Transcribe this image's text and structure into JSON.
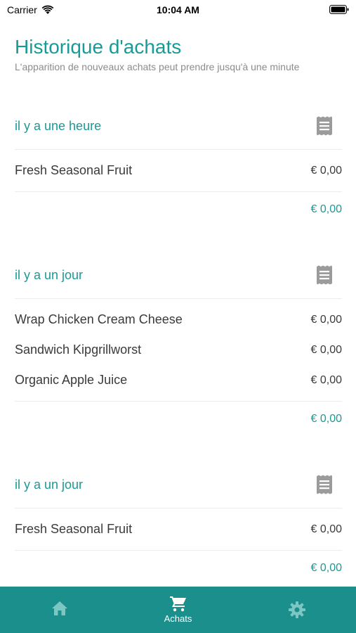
{
  "status_bar": {
    "carrier": "Carrier",
    "time": "10:04 AM"
  },
  "header": {
    "title": "Historique d'achats",
    "subtitle": "L'apparition de nouveaux achats peut prendre jusqu'à une minute"
  },
  "groups": [
    {
      "time": "il y a une heure",
      "items": [
        {
          "name": "Fresh Seasonal Fruit",
          "price": "€ 0,00"
        }
      ],
      "total": "€ 0,00"
    },
    {
      "time": "il y a un jour",
      "items": [
        {
          "name": "Wrap Chicken Cream Cheese",
          "price": "€ 0,00"
        },
        {
          "name": "Sandwich Kipgrillworst",
          "price": "€ 0,00"
        },
        {
          "name": "Organic Apple Juice",
          "price": "€ 0,00"
        }
      ],
      "total": "€ 0,00"
    },
    {
      "time": "il y a un jour",
      "items": [
        {
          "name": "Fresh Seasonal Fruit",
          "price": "€ 0,00"
        }
      ],
      "total": "€ 0,00"
    }
  ],
  "tabbar": {
    "tabs": [
      {
        "icon": "home-icon",
        "label": ""
      },
      {
        "icon": "cart-icon",
        "label": "Achats",
        "active": true
      },
      {
        "icon": "gear-icon",
        "label": ""
      }
    ]
  },
  "colors": {
    "accent": "#1a9a96",
    "tabbar": "#1a8f8b",
    "inactive_icon": "#7cc7c4"
  }
}
